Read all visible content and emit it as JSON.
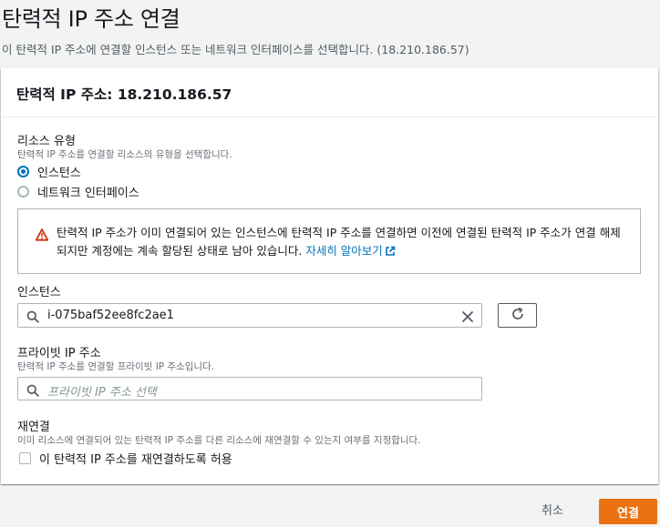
{
  "header": {
    "title": "탄력적 IP 주소 연결",
    "description": "이 탄력적 IP 주소에 연결할 인스턴스 또는 네트워크 인터페이스를 선택합니다. (18.210.186.57)"
  },
  "panel": {
    "title": "탄력적 IP 주소: 18.210.186.57"
  },
  "resource_type": {
    "label": "리소스 유형",
    "description": "탄력적 IP 주소를 연결할 리소스의 유형을 선택합니다.",
    "options": [
      {
        "label": "인스턴스",
        "selected": true
      },
      {
        "label": "네트워크 인터페이스",
        "selected": false
      }
    ]
  },
  "alert": {
    "icon": "warning-icon",
    "text": "탄력적 IP 주소가 이미 연결되어 있는 인스턴스에 탄력적 IP 주소를 연결하면 이전에 연결된 탄력적 IP 주소가 연결 해제되지만 계정에는 계속 할당된 상태로 남아 있습니다.",
    "link": "자세히 알아보기",
    "color": "#d13212"
  },
  "instance": {
    "label": "인스턴스",
    "value": "i-075baf52ee8fc2ae1"
  },
  "private_ip": {
    "label": "프라이빗 IP 주소",
    "description": "탄력적 IP 주소를 연결할 프라이빗 IP 주소입니다.",
    "placeholder": "프라이빗 IP 주소 선택"
  },
  "reassociation": {
    "label": "재연결",
    "description": "이미 리소스에 연결되어 있는 탄력적 IP 주소를 다른 리소스에 재연결할 수 있는지 여부를 지정합니다.",
    "checkbox_label": "이 탄력적 IP 주소를 재연결하도록 허용",
    "checked": false
  },
  "actions": {
    "cancel": "취소",
    "confirm": "연결"
  },
  "colors": {
    "accent": "#0073bb",
    "primary_button": "#ec7211"
  }
}
